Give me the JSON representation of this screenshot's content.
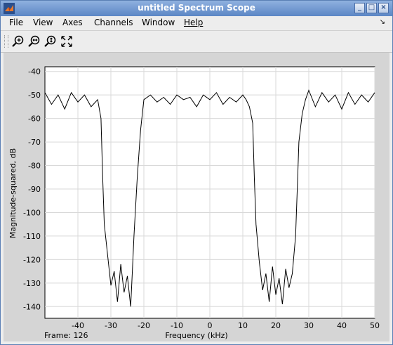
{
  "window": {
    "title": "untitled Spectrum Scope"
  },
  "menu": {
    "file": "File",
    "view": "View",
    "axes": "Axes",
    "channels": "Channels",
    "window": "Window",
    "help": "Help"
  },
  "toolbar": {
    "icons": [
      "zoom-in-icon",
      "zoom-x-icon",
      "zoom-y-icon",
      "autoscale-icon"
    ]
  },
  "status": {
    "frame": "Frame: 126"
  },
  "chart_data": {
    "type": "line",
    "xlabel": "Frequency (kHz)",
    "ylabel": "Magnitude-squared, dB",
    "xlim": [
      -50,
      50
    ],
    "ylim": [
      -145,
      -38
    ],
    "xticks": [
      -40,
      -30,
      -20,
      -10,
      0,
      10,
      20,
      30,
      40,
      50
    ],
    "yticks": [
      -40,
      -50,
      -60,
      -70,
      -80,
      -90,
      -100,
      -110,
      -120,
      -130,
      -140
    ],
    "grid": true,
    "series": [
      {
        "x": [
          -50,
          -48,
          -46,
          -44,
          -42,
          -40,
          -38,
          -36,
          -34,
          -33,
          -32.5,
          -32,
          -31,
          -30,
          -29,
          -28,
          -27,
          -26,
          -25,
          -24,
          -23.5,
          -23,
          -22,
          -21,
          -20,
          -18,
          -16,
          -14,
          -12,
          -10,
          -8,
          -6,
          -4,
          -2,
          0,
          2,
          4,
          6,
          8,
          10,
          11,
          12,
          13,
          13.5,
          14,
          15,
          16,
          17,
          18,
          19,
          20,
          21,
          22,
          23,
          24,
          25,
          26,
          26.5,
          27,
          28,
          29,
          30,
          32,
          34,
          36,
          38,
          40,
          42,
          44,
          46,
          48,
          50
        ],
        "y": [
          -49,
          -54,
          -50,
          -56,
          -49,
          -53,
          -50,
          -55,
          -52,
          -60,
          -85,
          -105,
          -118,
          -131,
          -125,
          -138,
          -122,
          -134,
          -127,
          -140,
          -125,
          -110,
          -85,
          -65,
          -52,
          -50,
          -53,
          -51,
          -54,
          -50,
          -52,
          -51,
          -55,
          -50,
          -52,
          -49,
          -54,
          -51,
          -53,
          -50,
          -52,
          -55,
          -62,
          -85,
          -105,
          -121,
          -133,
          -126,
          -138,
          -123,
          -135,
          -128,
          -139,
          -124,
          -132,
          -126,
          -110,
          -90,
          -70,
          -58,
          -52,
          -48,
          -55,
          -49,
          -53,
          -50,
          -56,
          -49,
          -54,
          -50,
          -53,
          -49
        ]
      }
    ]
  }
}
